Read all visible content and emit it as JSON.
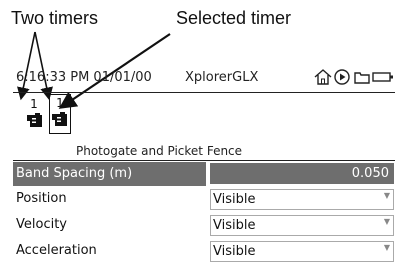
{
  "annotations": {
    "two_timers": "Two timers",
    "selected_timer": "Selected timer"
  },
  "status_bar": {
    "datetime": "6:16:33 PM  01/01/00",
    "app_name": "XplorerGLX"
  },
  "timers": [
    {
      "number": "1",
      "selected": false
    },
    {
      "number": "1",
      "selected": true
    }
  ],
  "sensor_title": "Photogate and Picket Fence",
  "properties": [
    {
      "label": "Band Spacing (m)",
      "value": "0.050",
      "selected": true
    },
    {
      "label": "Position",
      "value": "Visible",
      "selected": false
    },
    {
      "label": "Velocity",
      "value": "Visible",
      "selected": false
    },
    {
      "label": "Acceleration",
      "value": "Visible",
      "selected": false
    }
  ],
  "icons": [
    "home-icon",
    "play-icon",
    "folder-icon",
    "battery-icon",
    "timer-icon"
  ],
  "colors": {
    "selected_row": "#6e6e6e"
  }
}
